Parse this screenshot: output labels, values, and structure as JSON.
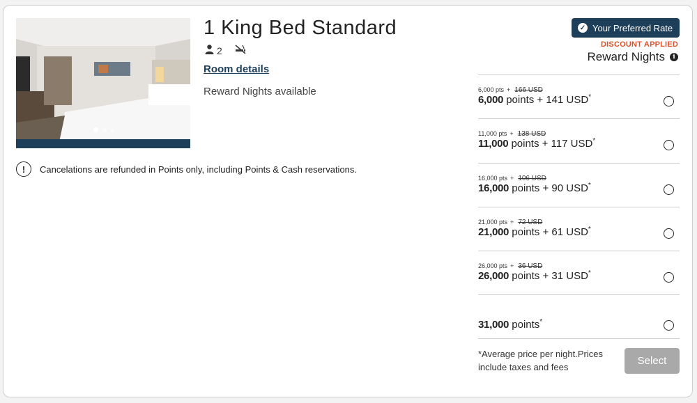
{
  "room": {
    "title": "1 King Bed Standard",
    "guests": "2",
    "details_link": "Room details",
    "reward_availability": "Reward Nights available",
    "photo_indicator": {
      "count": 3,
      "active": 1
    }
  },
  "policy": {
    "cancellation": "Cancelations are refunded in Points only, including Points & Cash reservations."
  },
  "rate_header": {
    "badge": "Your Preferred Rate",
    "discount": "DISCOUNT APPLIED",
    "label": "Reward Nights"
  },
  "rates": [
    {
      "small_pts": "6,000 pts",
      "plus": "+",
      "original": "166 USD",
      "points": "6,000",
      "cash": "points + 141 USD",
      "star": "*"
    },
    {
      "small_pts": "11,000 pts",
      "plus": "+",
      "original": "138 USD",
      "points": "11,000",
      "cash": "points + 117 USD",
      "star": "*"
    },
    {
      "small_pts": "16,000 pts",
      "plus": "+",
      "original": "106 USD",
      "points": "16,000",
      "cash": "points + 90 USD",
      "star": "*"
    },
    {
      "small_pts": "21,000 pts",
      "plus": "+",
      "original": "72 USD",
      "points": "21,000",
      "cash": "points + 61 USD",
      "star": "*"
    },
    {
      "small_pts": "26,000 pts",
      "plus": "+",
      "original": "36 USD",
      "points": "26,000",
      "cash": "points + 31 USD",
      "star": "*"
    },
    {
      "points": "31,000",
      "cash": "points",
      "star": "*"
    }
  ],
  "footer": {
    "note": "*Average price per night.Prices include taxes and fees",
    "select_label": "Select"
  },
  "colors": {
    "brand_navy": "#1d3f5a",
    "discount_orange": "#d9532c",
    "disabled_button": "#a9a9a9"
  },
  "icons": [
    "person-icon",
    "no-smoking-icon",
    "check-circle-icon",
    "info-icon",
    "alert-circle-icon"
  ]
}
